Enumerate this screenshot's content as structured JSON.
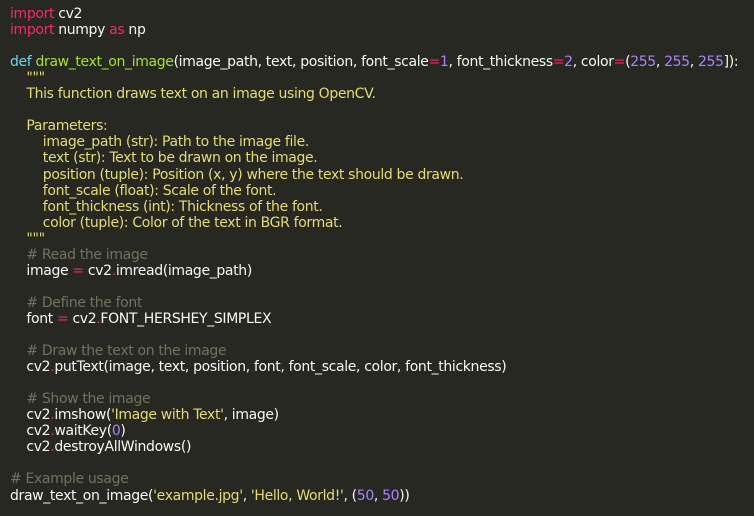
{
  "editor": {
    "language": "python",
    "theme": {
      "background": "#272822",
      "text": "#f8f8f2",
      "keyword": "#f92672",
      "definition": "#66d9ef",
      "function": "#a6e22e",
      "number": "#ae81ff",
      "string": "#e6db74",
      "comment": "#75715e"
    },
    "lines": [
      [
        [
          "kw",
          "import"
        ],
        [
          "txt",
          " cv2"
        ]
      ],
      [
        [
          "kw",
          "import"
        ],
        [
          "txt",
          " numpy "
        ],
        [
          "kw",
          "as"
        ],
        [
          "txt",
          " np"
        ]
      ],
      [],
      [
        [
          "def",
          "def"
        ],
        [
          "txt",
          " "
        ],
        [
          "fn",
          "draw_text_on_image"
        ],
        [
          "txt",
          "(image_path, text, position, font_scale"
        ],
        [
          "op",
          "="
        ],
        [
          "num",
          "1"
        ],
        [
          "txt",
          ", font_thickness"
        ],
        [
          "op",
          "="
        ],
        [
          "num",
          "2"
        ],
        [
          "txt",
          ", color"
        ],
        [
          "op",
          "="
        ],
        [
          "txt",
          "("
        ],
        [
          "num",
          "255"
        ],
        [
          "txt",
          ", "
        ],
        [
          "num",
          "255"
        ],
        [
          "txt",
          ", "
        ],
        [
          "num",
          "255"
        ],
        [
          "txt",
          "]):"
        ]
      ],
      [
        [
          "doc",
          "    \"\"\""
        ]
      ],
      [
        [
          "doc",
          "    This function draws text on an image using OpenCV."
        ]
      ],
      [],
      [
        [
          "doc",
          "    Parameters:"
        ]
      ],
      [
        [
          "doc",
          "        image_path (str): Path to the image file."
        ]
      ],
      [
        [
          "doc",
          "        text (str): Text to be drawn on the image."
        ]
      ],
      [
        [
          "doc",
          "        position (tuple): Position (x, y) where the text should be drawn."
        ]
      ],
      [
        [
          "doc",
          "        font_scale (float): Scale of the font."
        ]
      ],
      [
        [
          "doc",
          "        font_thickness (int): Thickness of the font."
        ]
      ],
      [
        [
          "doc",
          "        color (tuple): Color of the text in BGR format."
        ]
      ],
      [
        [
          "doc",
          "    \"\"\""
        ]
      ],
      [
        [
          "cmt",
          "    # Read the image"
        ]
      ],
      [
        [
          "txt",
          "    image "
        ],
        [
          "op",
          "="
        ],
        [
          "txt",
          " cv2"
        ],
        [
          "op",
          "."
        ],
        [
          "txt",
          "imread(image_path)"
        ]
      ],
      [],
      [
        [
          "cmt",
          "    # Define the font"
        ]
      ],
      [
        [
          "txt",
          "    font "
        ],
        [
          "op",
          "="
        ],
        [
          "txt",
          " cv2"
        ],
        [
          "op",
          "."
        ],
        [
          "txt",
          "FONT_HERSHEY_SIMPLEX"
        ]
      ],
      [],
      [
        [
          "cmt",
          "    # Draw the text on the image"
        ]
      ],
      [
        [
          "txt",
          "    cv2"
        ],
        [
          "op",
          "."
        ],
        [
          "txt",
          "putText(image, text, position, font, font_scale, color, font_thickness)"
        ]
      ],
      [],
      [
        [
          "cmt",
          "    # Show the image"
        ]
      ],
      [
        [
          "txt",
          "    cv2"
        ],
        [
          "op",
          "."
        ],
        [
          "txt",
          "imshow("
        ],
        [
          "str",
          "'Image with Text'"
        ],
        [
          "txt",
          ", image)"
        ]
      ],
      [
        [
          "txt",
          "    cv2"
        ],
        [
          "op",
          "."
        ],
        [
          "txt",
          "waitKey("
        ],
        [
          "num",
          "0"
        ],
        [
          "txt",
          ")"
        ]
      ],
      [
        [
          "txt",
          "    cv2"
        ],
        [
          "op",
          "."
        ],
        [
          "txt",
          "destroyAllWindows()"
        ]
      ],
      [],
      [
        [
          "cmt",
          "# Example usage"
        ]
      ],
      [
        [
          "txt",
          "draw_text_on_image("
        ],
        [
          "str",
          "'example.jpg'"
        ],
        [
          "txt",
          ", "
        ],
        [
          "str",
          "'Hello, World!'"
        ],
        [
          "txt",
          ", ("
        ],
        [
          "num",
          "50"
        ],
        [
          "txt",
          ", "
        ],
        [
          "num",
          "50"
        ],
        [
          "txt",
          "))"
        ]
      ]
    ]
  }
}
